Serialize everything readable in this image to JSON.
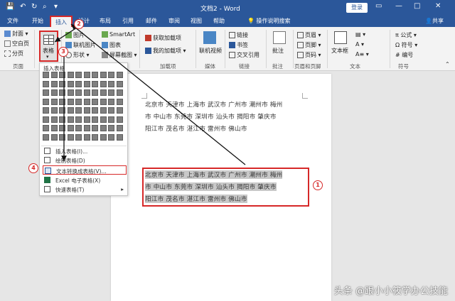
{
  "window": {
    "title": "文档2 - Word",
    "login_label": "登录",
    "share_label": "共享",
    "tell_me": "操作说明搜索"
  },
  "tabs": [
    "文件",
    "开始",
    "插入",
    "设计",
    "布局",
    "引用",
    "邮件",
    "审阅",
    "视图",
    "帮助"
  ],
  "ribbon": {
    "pages": {
      "cover": "封面",
      "blank": "空白页",
      "break": "分页",
      "group": "页面"
    },
    "table": {
      "label": "表格",
      "group": "表格"
    },
    "illustrations": {
      "pictures": "图片",
      "online_pictures": "联机图片",
      "shapes": "形状",
      "smartart": "SmartArt",
      "chart": "图表",
      "screenshot": "屏幕截图"
    },
    "addins": {
      "get": "获取加载项",
      "my": "我的加载项",
      "group": "加载项"
    },
    "media": {
      "video": "联机视频",
      "group": "媒体"
    },
    "links": {
      "link": "链接",
      "bookmark": "书签",
      "crossref": "交叉引用",
      "group": "链接"
    },
    "comments": {
      "comment": "批注",
      "group": "批注"
    },
    "header_footer": {
      "header": "页眉",
      "footer": "页脚",
      "page_number": "页码",
      "group": "页眉和页脚"
    },
    "text": {
      "textbox": "文本框",
      "group": "文本"
    },
    "symbols": {
      "formula": "公式",
      "symbol": "符号",
      "number": "编号",
      "group": "符号"
    }
  },
  "dropdown": {
    "header": "插入表格",
    "items": [
      {
        "label": "插入表格(I)...",
        "icon": "table-icon"
      },
      {
        "label": "绘制表格(D)",
        "icon": "pencil-icon"
      },
      {
        "label": "文本转换成表格(V)...",
        "icon": "convert-icon"
      },
      {
        "label": "Excel 电子表格(X)",
        "icon": "excel-icon"
      },
      {
        "label": "快速表格(T)",
        "icon": "quick-table-icon",
        "arrow": "▸"
      }
    ]
  },
  "document": {
    "top_lines": [
      "北京市  天津市  上海市  武汉市  广州市  潮州市  梅州",
      "市  中山市  东莞市  深圳市  汕头市  揭阳市  肇庆市",
      "阳江市  茂名市  湛江市  雷州市  佛山市"
    ],
    "selected_lines": [
      "北京市  天津市  上海市  武汉市  广州市  潮州市  梅州",
      "市  中山市  东莞市  深圳市  汕头市  揭阳市  肇庆市",
      "阳江市  茂名市  湛江市  雷州市  佛山市"
    ]
  },
  "annotations": {
    "b1": "1",
    "b2": "2",
    "b3": "3",
    "b4": "4"
  },
  "watermark": "头条 @跟小小筱学办公技能",
  "colors": {
    "titlebar": "#2b579a",
    "ribbon": "#f3f3f3",
    "highlight": "#d62828",
    "selection": "#c8c8c8"
  }
}
